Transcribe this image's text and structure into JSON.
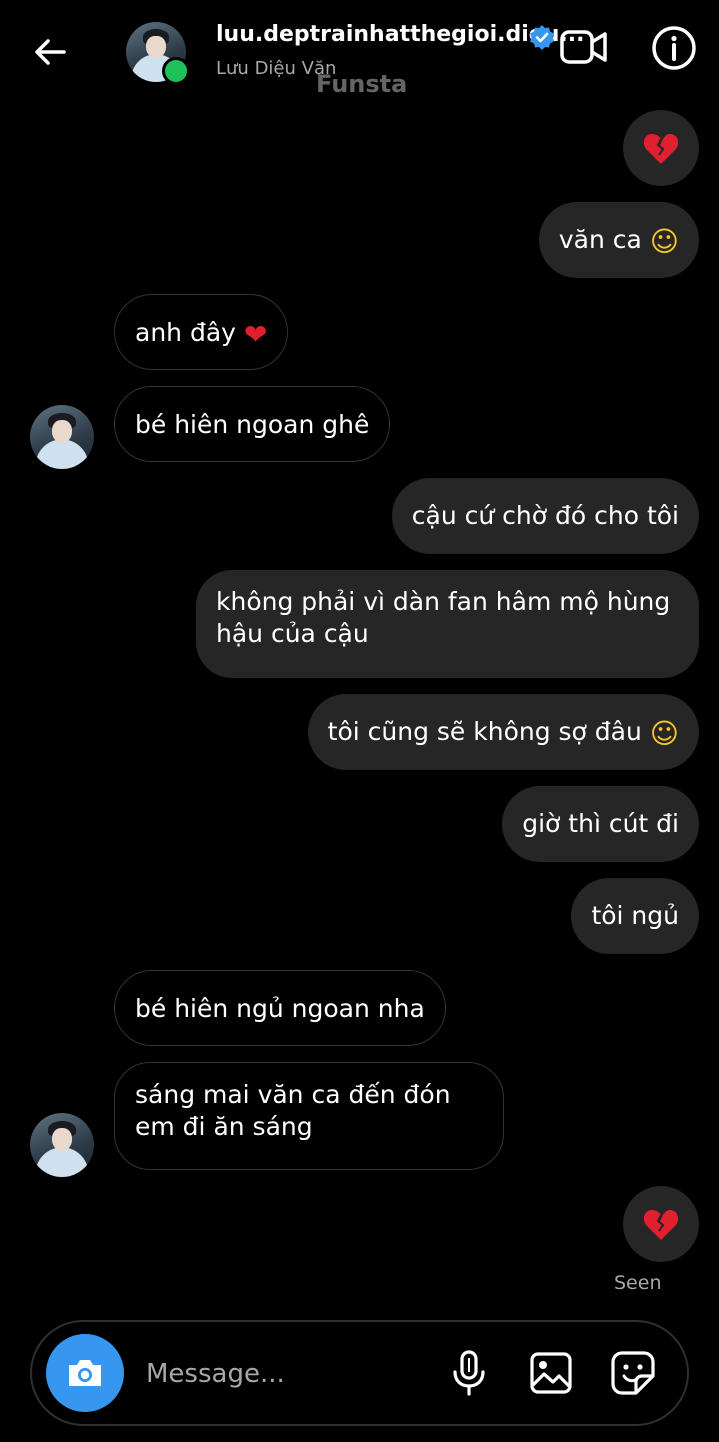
{
  "header": {
    "username": "luu.deptrainhatthegioi.dieu...",
    "display_name": "Lưu Diệu Văn",
    "watermark": "Funsta",
    "back_icon": "arrow-left-icon",
    "verified_icon": "verified-badge-icon",
    "video_icon": "video-camera-icon",
    "info_icon": "info-icon"
  },
  "messages": [
    {
      "side": "out",
      "type": "emoji",
      "icon": "broken-heart-icon"
    },
    {
      "side": "out",
      "text": "văn ca",
      "emoji": "☺"
    },
    {
      "side": "in",
      "text": "anh đây",
      "emoji": "❤"
    },
    {
      "side": "in",
      "text": "bé hiên ngoan ghê"
    },
    {
      "side": "out",
      "text": "cậu cứ chờ đó cho tôi"
    },
    {
      "side": "out",
      "text": "không phải vì dàn fan hâm mộ hùng hậu của cậu"
    },
    {
      "side": "out",
      "text": "tôi cũng sẽ không sợ đâu",
      "emoji": "☺"
    },
    {
      "side": "out",
      "text": "giờ thì cút đi"
    },
    {
      "side": "out",
      "text": "tôi ngủ"
    },
    {
      "side": "in",
      "text": "bé hiên ngủ ngoan nha"
    },
    {
      "side": "in",
      "text": "sáng mai văn ca đến đón em đi ăn sáng"
    },
    {
      "side": "out",
      "type": "emoji",
      "icon": "broken-heart-icon"
    }
  ],
  "status": {
    "seen": "Seen"
  },
  "composer": {
    "placeholder": "Message...",
    "camera_icon": "camera-icon",
    "mic_icon": "microphone-icon",
    "gallery_icon": "image-icon",
    "sticker_icon": "sticker-icon"
  },
  "colors": {
    "background": "#000000",
    "outgoing_bubble": "#262626",
    "incoming_border": "#333333",
    "accent": "#3797f0",
    "online": "#1ec15a",
    "heart": "#e0202f"
  }
}
